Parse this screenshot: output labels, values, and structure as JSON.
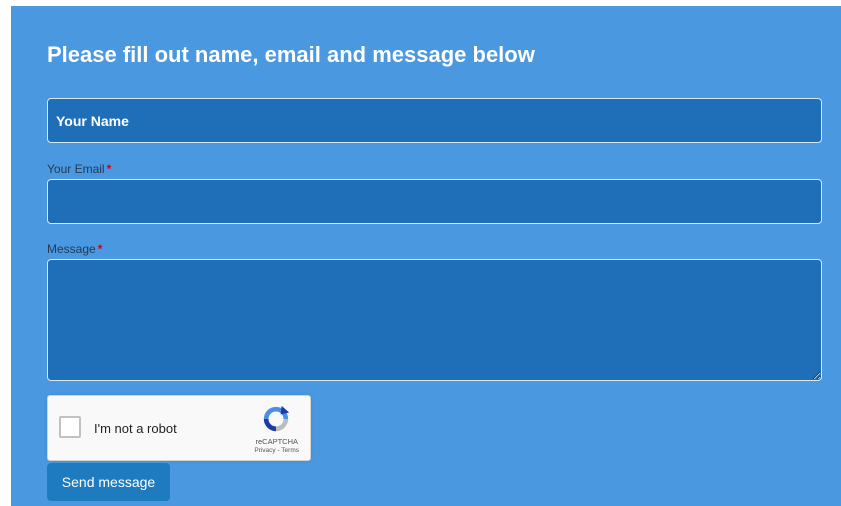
{
  "form": {
    "title": "Please fill out name, email and message below",
    "name_placeholder": "Your Name",
    "email_label": "Your Email",
    "message_label": "Message",
    "required_marker": "*",
    "send_label": "Send message"
  },
  "recaptcha": {
    "checkbox_label": "I'm not a robot",
    "brand": "reCAPTCHA",
    "privacy": "Privacy",
    "separator": " - ",
    "terms": "Terms",
    "icon": "recaptcha-logo-icon"
  },
  "colors": {
    "panel": "#4a98e0",
    "field": "#1e6fb8",
    "button": "#1f7bc0",
    "required": "#d0021b"
  }
}
